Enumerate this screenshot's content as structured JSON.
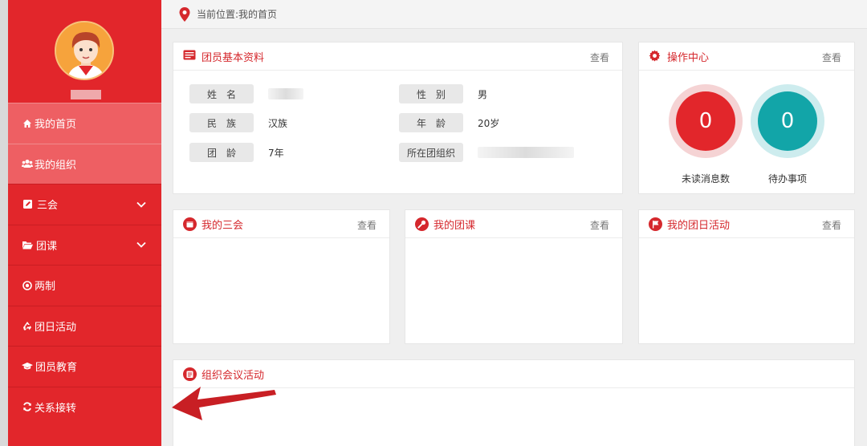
{
  "breadcrumb": "当前位置:我的首页",
  "sidebar": {
    "items": [
      {
        "label": "我的首页",
        "icon": "home-icon"
      },
      {
        "label": "我的组织",
        "icon": "users-icon"
      },
      {
        "label": "三会",
        "icon": "edit-icon"
      },
      {
        "label": "团课",
        "icon": "folder-icon"
      },
      {
        "label": "两制",
        "icon": "target-icon"
      },
      {
        "label": "团日活动",
        "icon": "recycle-icon"
      },
      {
        "label": "团员教育",
        "icon": "graduation-cap-icon"
      },
      {
        "label": "关系接转",
        "icon": "refresh-icon"
      }
    ]
  },
  "profile_panel": {
    "title": "团员基本资料",
    "more": "查看",
    "fields": {
      "name_label": "姓　名",
      "gender_label": "性　别",
      "gender_value": "男",
      "ethnicity_label": "民　族",
      "ethnicity_value": "汉族",
      "age_label": "年　龄",
      "age_value": "20岁",
      "league_age_label": "团　龄",
      "league_age_value": "7年",
      "org_label": "所在团组织"
    }
  },
  "ops_panel": {
    "title": "操作中心",
    "more": "查看",
    "unread_count": "0",
    "unread_label": "未读消息数",
    "todo_count": "0",
    "todo_label": "待办事项"
  },
  "sanhui_panel": {
    "title": "我的三会",
    "more": "查看"
  },
  "tuanke_panel": {
    "title": "我的团课",
    "more": "查看"
  },
  "tuanri_panel": {
    "title": "我的团日活动",
    "more": "查看"
  },
  "meeting_panel": {
    "title": "组织会议活动"
  },
  "colors": {
    "brand_red": "#e2262b",
    "teal": "#12a5a8"
  }
}
